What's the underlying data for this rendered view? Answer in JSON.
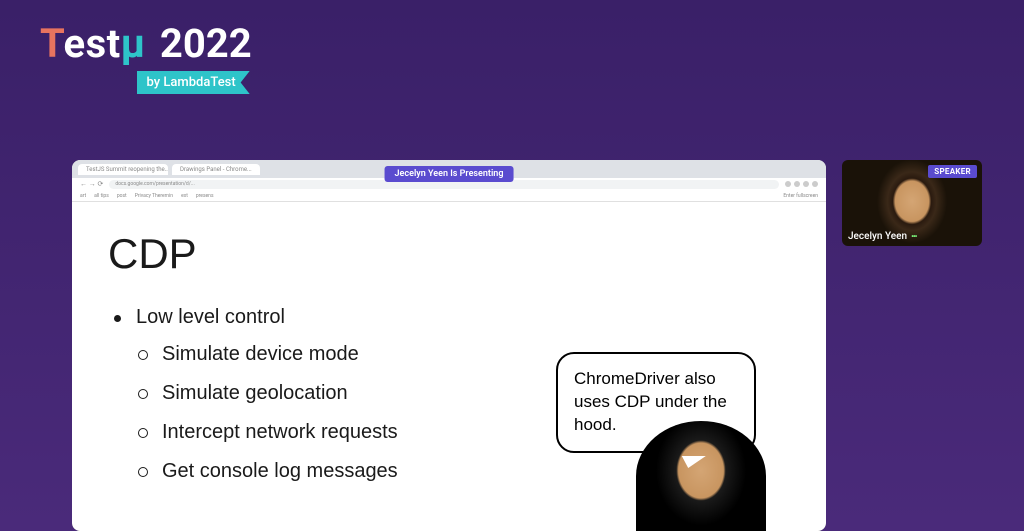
{
  "event": {
    "logo_test_prefix": "T",
    "logo_test_mid": "est",
    "logo_test_mu": "μ",
    "year": "2022",
    "byline": "by LambdaTest"
  },
  "presentation": {
    "presenting_badge": "Jecelyn Yeen Is Presenting",
    "browser": {
      "tabs": [
        "TestJS Summit reopening the...",
        "Drawings Panel - Chrome..."
      ],
      "address": "docs.google.com/presentation/d/...",
      "bookmarks": [
        "art",
        "all tips",
        "post",
        "Privacy Theremin",
        "ext",
        "presens"
      ],
      "fullscreen_hint": "Enter fullscreen"
    },
    "slide": {
      "title": "CDP",
      "bullet_main": "Low level control",
      "sub_bullets": [
        "Simulate device mode",
        "Simulate geolocation",
        "Intercept network requests",
        "Get console log messages"
      ],
      "speech_bubble": "ChromeDriver also uses CDP under the hood."
    }
  },
  "speaker": {
    "badge": "SPEAKER",
    "name": "Jecelyn Yeen"
  }
}
